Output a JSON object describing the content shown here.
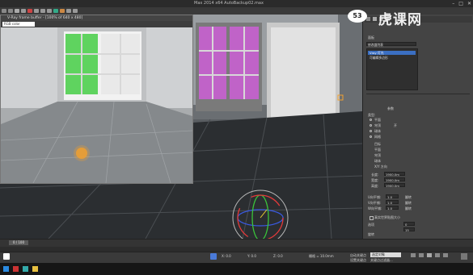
{
  "app": {
    "title": "Max  2014 x64      AutoBackup02.max",
    "window_controls": [
      "–",
      "□",
      "✕"
    ]
  },
  "frame_buffer": {
    "title": "V-Ray frame buffer - [100% of 640 x 480]",
    "channel": "RGB color"
  },
  "watermark": {
    "text": "虎课网",
    "badge": "53"
  },
  "command_panel": {
    "section_title": "修改器列表",
    "tab_label": "面板",
    "modifier_items": [
      {
        "label": "Vray 灯光",
        "selected": true
      },
      {
        "label": "可编辑多边形",
        "selected": false
      }
    ],
    "rollout_title": "参数",
    "group_label": "类型:",
    "type_options": [
      "平面",
      "穹顶",
      "球体",
      "网格"
    ],
    "checkbox_label": "开",
    "targeted_label": "目标",
    "sub_options": [
      "平面",
      "穹顶",
      "球体",
      "X/Y 方向"
    ],
    "size_rows": [
      {
        "label": "长度:",
        "value": "1900.0m"
      },
      {
        "label": "宽度:",
        "value": "1900.0m"
      },
      {
        "label": "高度:",
        "value": "1900.0m"
      }
    ],
    "seg_rows": [
      {
        "label": "U向平铺:",
        "value": "1.0",
        "extra": "翻转"
      },
      {
        "label": "V向平铺:",
        "value": "1.0",
        "extra": "翻转"
      },
      {
        "label": "W向平铺:",
        "value": "1.0",
        "extra": "翻转"
      }
    ],
    "bottom_check": "真实世界贴图大小",
    "output_label": "选项",
    "output_value": "0",
    "bottom_value": "15",
    "rotate_label": "旋转"
  },
  "timeline": {
    "frame_label": "0 / 100"
  },
  "statusbar": {
    "coords": [
      "X: 0.0",
      "Y: 0.0",
      "Z: 0.0"
    ],
    "grid": "栅格 = 10.0mm",
    "auto_key": "自动关键点",
    "set_key": "设置关键点",
    "selected": "选定对象",
    "filter": "关键点过滤器..."
  },
  "colors": {
    "viewport_bg": "#5a5e62",
    "panel_bg": "#444444",
    "selection_blue": "#3b6fc2",
    "gizmo_red": "#e23a3a",
    "gizmo_green": "#3ac43a",
    "gizmo_blue": "#3a5ae2",
    "highlight_orange": "#f0a030"
  }
}
